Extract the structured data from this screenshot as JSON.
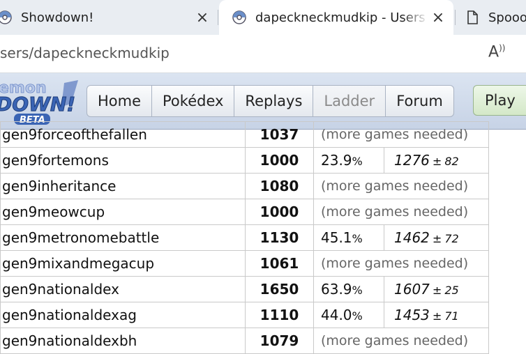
{
  "browser": {
    "tabs": [
      {
        "title": "Showdown!",
        "icon": "pokeball-icon"
      },
      {
        "title": "dapeckneckmudkip - Users - P",
        "icon": "pokeball-icon",
        "active": true
      },
      {
        "title": "Spooo",
        "icon": "document-icon"
      }
    ],
    "url": "sers/dapeckneckmudkip"
  },
  "header": {
    "logo_lines": [
      "emon",
      "DOWN!",
      "BETA"
    ],
    "nav": [
      "Home",
      "Pokédex",
      "Replays",
      "Ladder",
      "Forum"
    ],
    "current_nav": "Ladder",
    "play_label": "Play"
  },
  "ratings": {
    "rows": [
      {
        "format": "gen9forceofthefallen",
        "elo": "1037",
        "more": "(more games needed)"
      },
      {
        "format": "gen9fortemons",
        "elo": "1000",
        "gxe": "23.9",
        "pct": "%",
        "glicko": "1276",
        "pm": "±",
        "dev": "82"
      },
      {
        "format": "gen9inheritance",
        "elo": "1080",
        "more": "(more games needed)"
      },
      {
        "format": "gen9meowcup",
        "elo": "1000",
        "more": "(more games needed)"
      },
      {
        "format": "gen9metronomebattle",
        "elo": "1130",
        "gxe": "45.1",
        "pct": "%",
        "glicko": "1462",
        "pm": "±",
        "dev": "72"
      },
      {
        "format": "gen9mixandmegacup",
        "elo": "1061",
        "more": "(more games needed)"
      },
      {
        "format": "gen9nationaldex",
        "elo": "1650",
        "gxe": "63.9",
        "pct": "%",
        "glicko": "1607",
        "pm": "±",
        "dev": "25"
      },
      {
        "format": "gen9nationaldexag",
        "elo": "1110",
        "gxe": "44.0",
        "pct": "%",
        "glicko": "1453",
        "pm": "±",
        "dev": "71"
      },
      {
        "format": "gen9nationaldexbh",
        "elo": "1079",
        "more": "(more games needed)"
      }
    ]
  }
}
